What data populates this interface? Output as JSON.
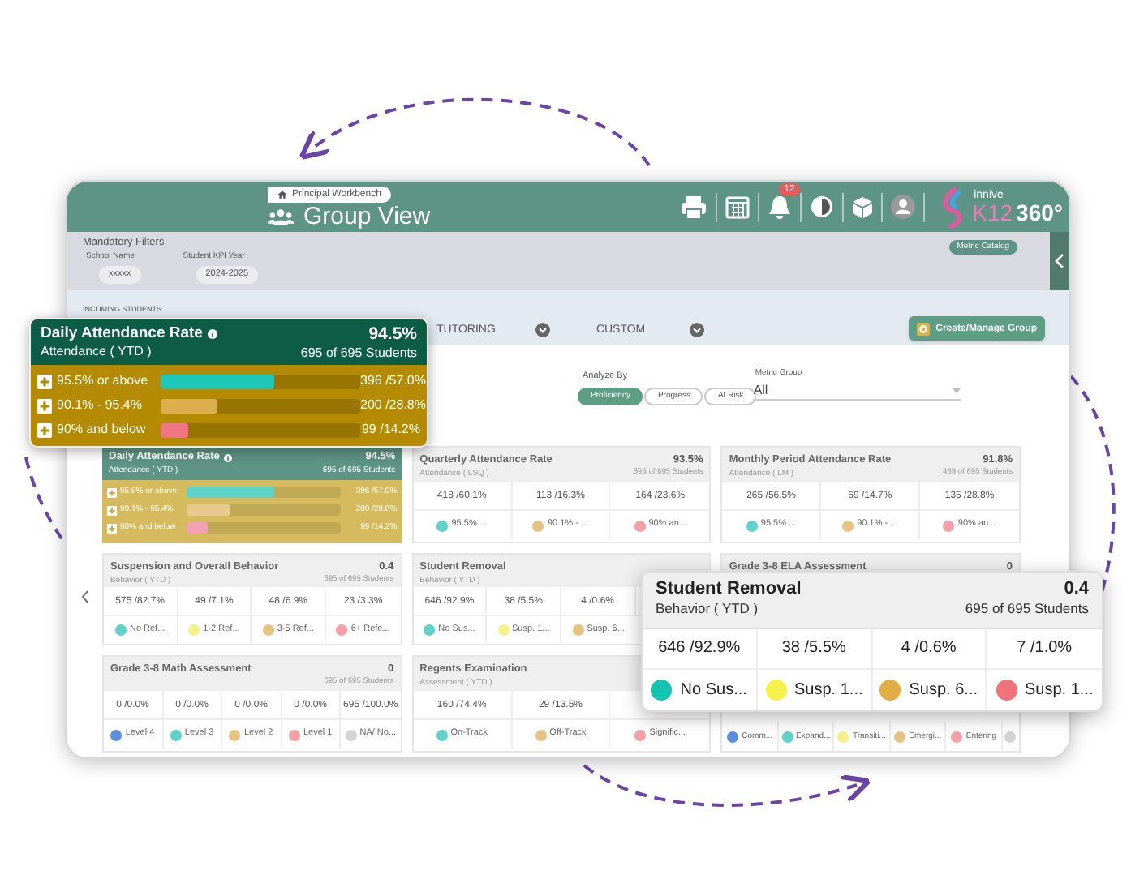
{
  "header": {
    "breadcrumb": "Principal Workbench",
    "title": "Group View",
    "notification_count": "12",
    "logo": {
      "brand": "innive",
      "product": "K12",
      "suffix": "360°"
    }
  },
  "filters": {
    "title": "Mandatory Filters",
    "fields": [
      {
        "label": "School Name",
        "value": "xxxxx"
      },
      {
        "label": "Student KPI Year",
        "value": "2024-2025"
      }
    ],
    "metric_catalog": "Metric Catalog"
  },
  "tabs_bar": {
    "section_label": "INCOMING STUDENTS",
    "tabs": [
      "TUTORING",
      "CUSTOM"
    ],
    "create_button": "Create/Manage Group"
  },
  "analyze": {
    "label": "Analyze By",
    "options": [
      {
        "label": "Proficiency",
        "selected": true
      },
      {
        "label": "Progress",
        "selected": false
      },
      {
        "label": "At Risk",
        "selected": false
      }
    ],
    "metric_group": {
      "label": "Metric Group",
      "value": "All"
    }
  },
  "cards": [
    {
      "kind": "bars",
      "title": "Daily Attendance Rate",
      "subtitle": "Attendance ( YTD )",
      "value": "94.5%",
      "students": "695 of 695 Students",
      "rows": [
        {
          "label": "95.5% or above",
          "level": 0.57,
          "count": "396 /57.0%",
          "color": "#5dd3c9"
        },
        {
          "label": "90.1% - 95.4%",
          "level": 0.288,
          "count": "200 /28.8%",
          "color": "#e9c98e"
        },
        {
          "label": "90% and below",
          "level": 0.142,
          "count": "99 /14.2%",
          "color": "#f2a2b4"
        }
      ]
    },
    {
      "kind": "stats",
      "title": "Quarterly Attendance Rate",
      "subtitle": "Attendance ( LSQ )",
      "value": "93.5%",
      "students": "695 of 695 Students",
      "cells": [
        {
          "count": "418 /60.1%",
          "legend": "95.5% ...",
          "color": "#5dd3c9"
        },
        {
          "count": "113 /16.3%",
          "legend": "90.1% - ...",
          "color": "#e6c382"
        },
        {
          "count": "164 /23.6%",
          "legend": "90% an...",
          "color": "#f5a0a8"
        }
      ]
    },
    {
      "kind": "stats",
      "title": "Monthly Period Attendance Rate",
      "subtitle": "Attendance ( LM )",
      "value": "91.8%",
      "students": "469 of 695 Students",
      "cells": [
        {
          "count": "265 /56.5%",
          "legend": "95.5% ...",
          "color": "#5dd3c9"
        },
        {
          "count": "69 /14.7%",
          "legend": "90.1% - ...",
          "color": "#e6c382"
        },
        {
          "count": "135 /28.8%",
          "legend": "90% an...",
          "color": "#f5a0a8"
        }
      ]
    },
    {
      "kind": "stats",
      "title": "Suspension and Overall Behavior",
      "subtitle": "Behavior ( YTD )",
      "value": "0.4",
      "students": "695 of 695 Students",
      "cells": [
        {
          "count": "575 /82.7%",
          "legend": "No Ref...",
          "color": "#5dd3c9"
        },
        {
          "count": "49 /7.1%",
          "legend": "1-2 Ref...",
          "color": "#f5f28a"
        },
        {
          "count": "48 /6.9%",
          "legend": "3-5 Ref...",
          "color": "#e6c382"
        },
        {
          "count": "23 /3.3%",
          "legend": "6+ Refe...",
          "color": "#f5a0a8"
        }
      ]
    },
    {
      "kind": "stats",
      "title": "Student Removal",
      "subtitle": "Behavior ( YTD )",
      "cells": [
        {
          "count": "646 /92.9%",
          "legend": "No Sus...",
          "color": "#5dd3c9"
        },
        {
          "count": "38 /5.5%",
          "legend": "Susp. 1...",
          "color": "#f5f28a"
        },
        {
          "count": "4 /0.6%",
          "legend": "Susp. 6...",
          "color": "#e6c382"
        }
      ]
    },
    {
      "kind": "legend_only",
      "title": "Grade 3-8 ELA Assessment",
      "value": "0",
      "cells": [
        {
          "legend": "Comm...",
          "color": "#5b8de0"
        },
        {
          "legend": "Expand...",
          "color": "#5dd3c9"
        },
        {
          "legend": "Transiti...",
          "color": "#f5f28a"
        },
        {
          "legend": "Emergi...",
          "color": "#e6c382"
        },
        {
          "legend": "Entering",
          "color": "#f5a0a8"
        },
        {
          "color": "#d4d4d4"
        }
      ]
    },
    {
      "kind": "stats",
      "title": "Grade 3-8 Math Assessment",
      "value": "0",
      "students": "695 of 695 Students",
      "cells": [
        {
          "count": "0 /0.0%",
          "legend": "Level 4",
          "color": "#5b8de0"
        },
        {
          "count": "0 /0.0%",
          "legend": "Level 3",
          "color": "#5dd3c9"
        },
        {
          "count": "0 /0.0%",
          "legend": "Level 2",
          "color": "#e6c382"
        },
        {
          "count": "0 /0.0%",
          "legend": "Level 1",
          "color": "#f5a0a8"
        },
        {
          "count": "695 /100.0%",
          "legend": "NA/ No...",
          "color": "#d4d4d4"
        }
      ]
    },
    {
      "kind": "stats",
      "title": "Regents Examination",
      "subtitle": "Assessment ( YTD )",
      "cells": [
        {
          "count": "160 /74.4%",
          "legend": "On-Track",
          "color": "#5dd3c9"
        },
        {
          "count": "29 /13.5%",
          "legend": "Off-Track",
          "color": "#e6c382"
        },
        {
          "legend": "Signific...",
          "color": "#f5a0a8"
        }
      ]
    }
  ],
  "popups": [
    {
      "kind": "bars",
      "title": "Daily Attendance Rate",
      "subtitle": "Attendance ( YTD )",
      "value": "94.5%",
      "students": "695 of 695 Students",
      "rows": [
        {
          "label": "95.5% or above",
          "level": 0.57,
          "count": "396 /57.0%",
          "color": "#1dc8b8"
        },
        {
          "label": "90.1% - 95.4%",
          "level": 0.288,
          "count": "200 /28.8%",
          "color": "#dcae4e"
        },
        {
          "label": "90% and below",
          "level": 0.142,
          "count": "99 /14.2%",
          "color": "#f07484"
        }
      ]
    },
    {
      "kind": "stats",
      "title": "Student Removal",
      "subtitle": "Behavior ( YTD )",
      "value": "0.4",
      "students": "695 of 695 Students",
      "cells": [
        {
          "count": "646 /92.9%",
          "legend": "No Sus...",
          "color": "#14c4b0"
        },
        {
          "count": "38 /5.5%",
          "legend": "Susp. 1...",
          "color": "#f5f04a"
        },
        {
          "count": "4 /0.6%",
          "legend": "Susp. 6...",
          "color": "#e3ad45"
        },
        {
          "count": "7 /1.0%",
          "legend": "Susp. 1...",
          "color": "#f0727a"
        }
      ]
    }
  ]
}
